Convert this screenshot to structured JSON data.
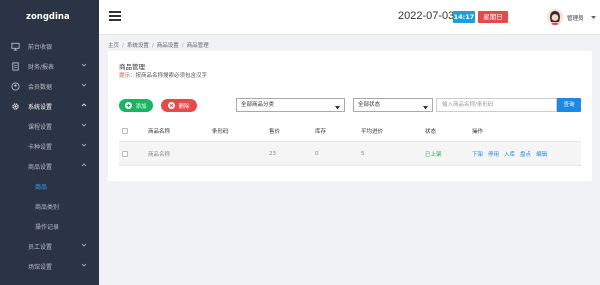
{
  "brand": "zongdina",
  "sidebar": {
    "items": [
      {
        "label": "前台收银",
        "icon": "monitor-icon",
        "chevron": false
      },
      {
        "label": "财务/报表",
        "icon": "document-icon",
        "chevron": true
      },
      {
        "label": "会员数据",
        "icon": "user-icon",
        "chevron": true
      },
      {
        "label": "系统设置",
        "icon": "gear-icon",
        "chevron": true
      }
    ],
    "sub_items": [
      {
        "label": "课程设置"
      },
      {
        "label": "卡种设置"
      },
      {
        "label": "商品设置"
      }
    ],
    "sub2_items": [
      {
        "label": "商品"
      },
      {
        "label": "商品类别"
      },
      {
        "label": "操作记录"
      }
    ],
    "after_items": [
      {
        "label": "员工设置"
      },
      {
        "label": "场馆设置"
      }
    ]
  },
  "header": {
    "date": "2022-07-03",
    "time": "14:17",
    "weekday": "星期日",
    "username": "管理员"
  },
  "breadcrumb": [
    "主页",
    "系统设置",
    "商品设置",
    "商品管理"
  ],
  "card": {
    "title": "商品管理",
    "hint_label": "提示：",
    "hint_text": "按商品名称搜索必须包含汉字"
  },
  "toolbar": {
    "add_label": "添加",
    "delete_label": "删除",
    "category_select": "全部商品分类",
    "status_select": "全部状态",
    "search_placeholder": "输入商品名称/条形码",
    "search_label": "查询"
  },
  "table": {
    "headers": [
      "商品名称",
      "条形码",
      "售价",
      "库存",
      "平均进价",
      "状态",
      "操作"
    ],
    "rows": [
      {
        "name": "商品名称",
        "barcode": "",
        "price": "23",
        "stock": "0",
        "avg_cost": "5",
        "status": "已上架",
        "ops": [
          "下架",
          "停用",
          "入库",
          "盘点",
          "编辑"
        ]
      }
    ]
  },
  "colors": {
    "sidebar_bg": "#2b3445",
    "active_link": "#3b9bff",
    "add_green": "#19b55f",
    "delete_red": "#e84a4a",
    "primary_blue": "#1e88e5",
    "time_badge": "#1e9fd8",
    "day_badge": "#e14b4b",
    "status_green": "#19a45a"
  }
}
